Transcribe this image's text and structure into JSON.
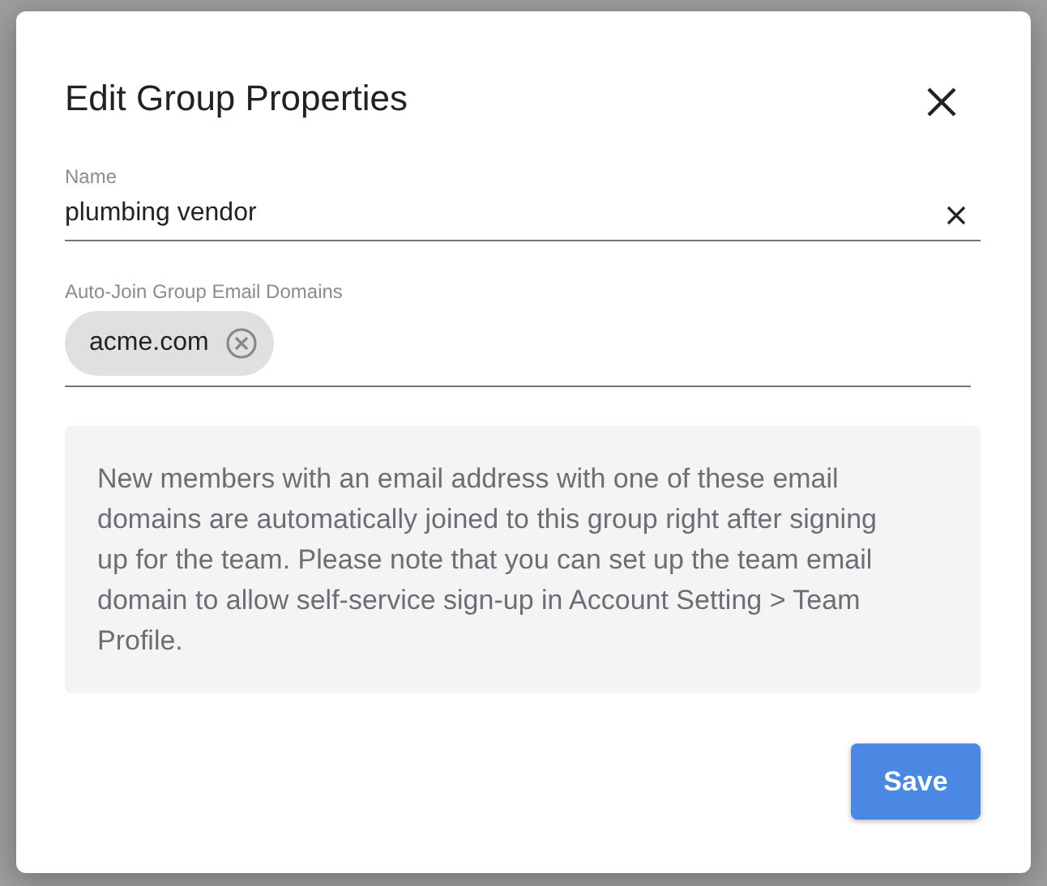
{
  "dialog": {
    "title": "Edit Group Properties"
  },
  "name_field": {
    "label": "Name",
    "value": "plumbing vendor"
  },
  "domains_field": {
    "label": "Auto-Join Group Email Domains",
    "chips": [
      "acme.com"
    ]
  },
  "info": "New members with an email address with one of these email domains are automatically joined to this group right after signing up for the team. Please note that you can set up the team email domain to allow self-service sign-up in Account Setting > Team Profile.",
  "buttons": [
    "Save"
  ]
}
